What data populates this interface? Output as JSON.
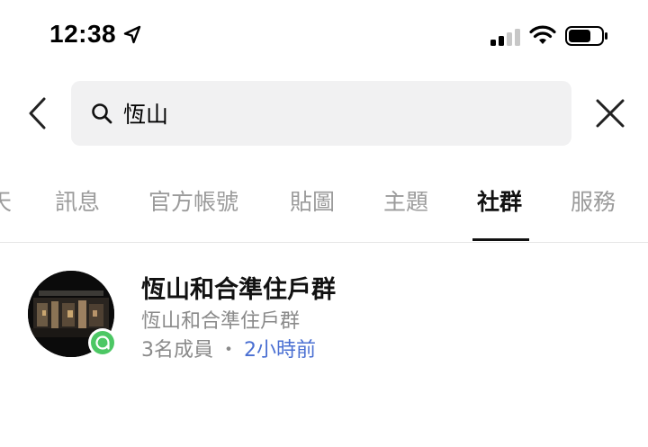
{
  "status_bar": {
    "time": "12:38",
    "icons": [
      "location-arrow-icon",
      "cellular-signal-icon",
      "wifi-icon",
      "battery-icon"
    ]
  },
  "search": {
    "query": "恆山",
    "icons": {
      "back": "chevron-left-icon",
      "search": "search-icon",
      "clear": "close-icon"
    }
  },
  "tabs": [
    {
      "label": "天"
    },
    {
      "label": "訊息"
    },
    {
      "label": "官方帳號"
    },
    {
      "label": "貼圖"
    },
    {
      "label": "主題"
    },
    {
      "label": "社群",
      "active": true
    },
    {
      "label": "服務"
    }
  ],
  "results": [
    {
      "title": "恆山和合準住戶群",
      "subtitle": "恆山和合準住戶群",
      "members": "3名成員",
      "separator": "・",
      "time": "2小時前",
      "badge_icon": "openchat-badge-icon"
    }
  ],
  "colors": {
    "accent_time": "#4a6fd2",
    "badge": "#4cc764",
    "tab_inactive": "#9b9b9b",
    "search_bg": "#f1f1f2"
  }
}
